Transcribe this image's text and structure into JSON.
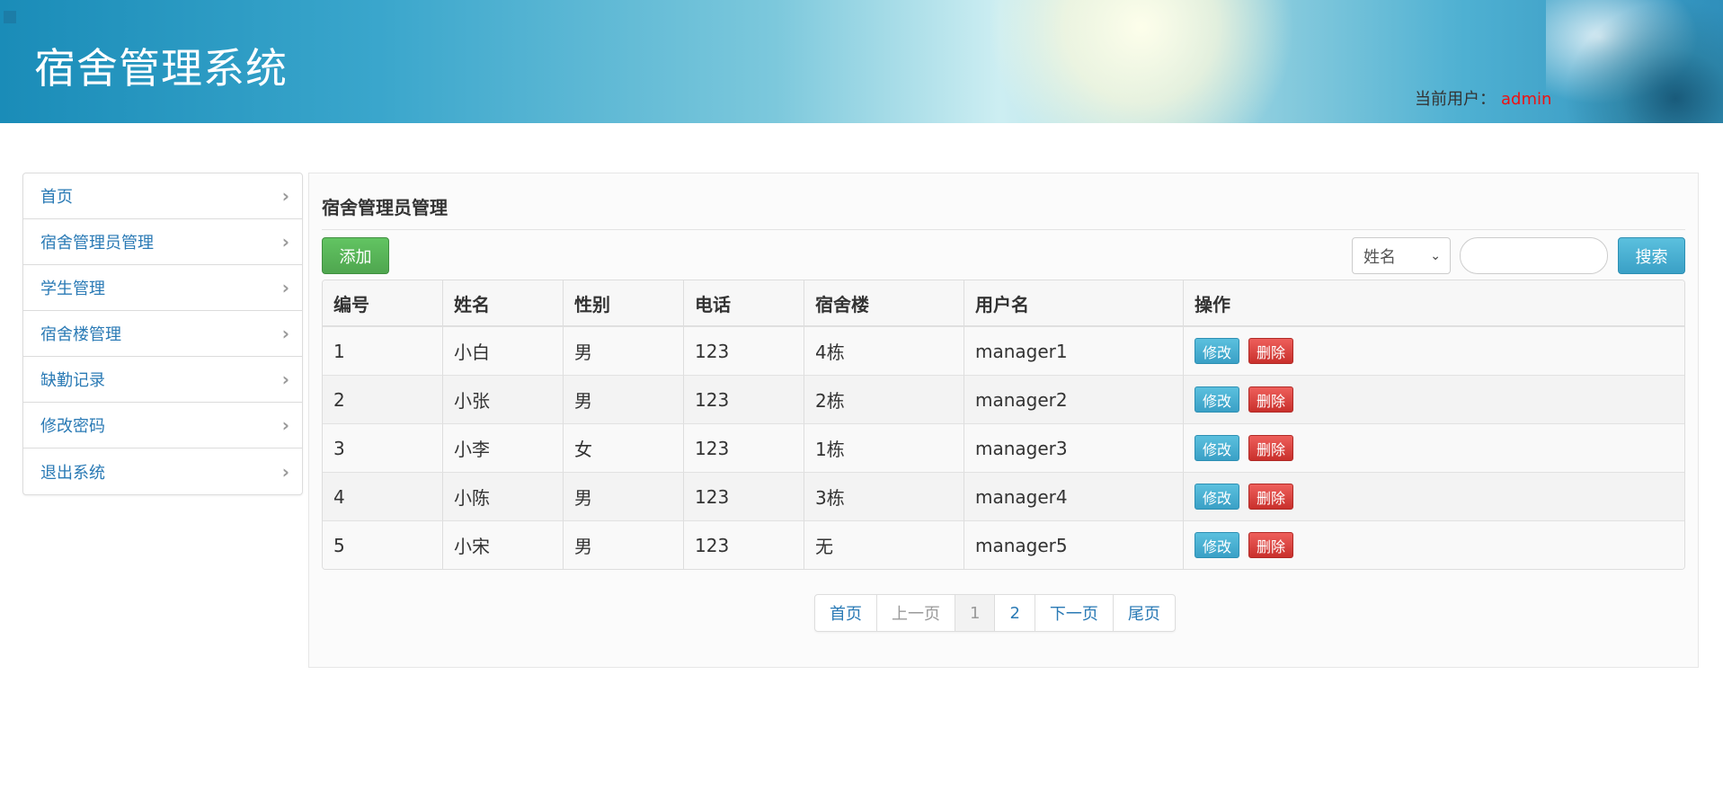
{
  "header": {
    "title": "宿舍管理系统",
    "user_label": "当前用户：",
    "user_name": "admin"
  },
  "sidebar": {
    "items": [
      {
        "label": "首页"
      },
      {
        "label": "宿舍管理员管理"
      },
      {
        "label": "学生管理"
      },
      {
        "label": "宿舍楼管理"
      },
      {
        "label": "缺勤记录"
      },
      {
        "label": "修改密码"
      },
      {
        "label": "退出系统"
      }
    ]
  },
  "main": {
    "title": "宿舍管理员管理",
    "add_label": "添加",
    "search": {
      "field_selected": "姓名",
      "input_value": "",
      "button_label": "搜索"
    },
    "table": {
      "headers": [
        "编号",
        "姓名",
        "性别",
        "电话",
        "宿舍楼",
        "用户名",
        "操作"
      ],
      "rows": [
        {
          "id": "1",
          "name": "小白",
          "gender": "男",
          "phone": "123",
          "building": "4栋",
          "username": "manager1"
        },
        {
          "id": "2",
          "name": "小张",
          "gender": "男",
          "phone": "123",
          "building": "2栋",
          "username": "manager2"
        },
        {
          "id": "3",
          "name": "小李",
          "gender": "女",
          "phone": "123",
          "building": "1栋",
          "username": "manager3"
        },
        {
          "id": "4",
          "name": "小陈",
          "gender": "男",
          "phone": "123",
          "building": "3栋",
          "username": "manager4"
        },
        {
          "id": "5",
          "name": "小宋",
          "gender": "男",
          "phone": "123",
          "building": "无",
          "username": "manager5"
        }
      ],
      "edit_label": "修改",
      "delete_label": "删除"
    },
    "pagination": {
      "first": "首页",
      "prev": "上一页",
      "pages": [
        "1",
        "2"
      ],
      "current": "1",
      "next": "下一页",
      "last": "尾页"
    }
  },
  "colors": {
    "link": "#2a7ab5",
    "accent_green": "#5cb85c",
    "accent_blue": "#5bc0de",
    "accent_red": "#d9534f",
    "user_name": "#e11111"
  }
}
